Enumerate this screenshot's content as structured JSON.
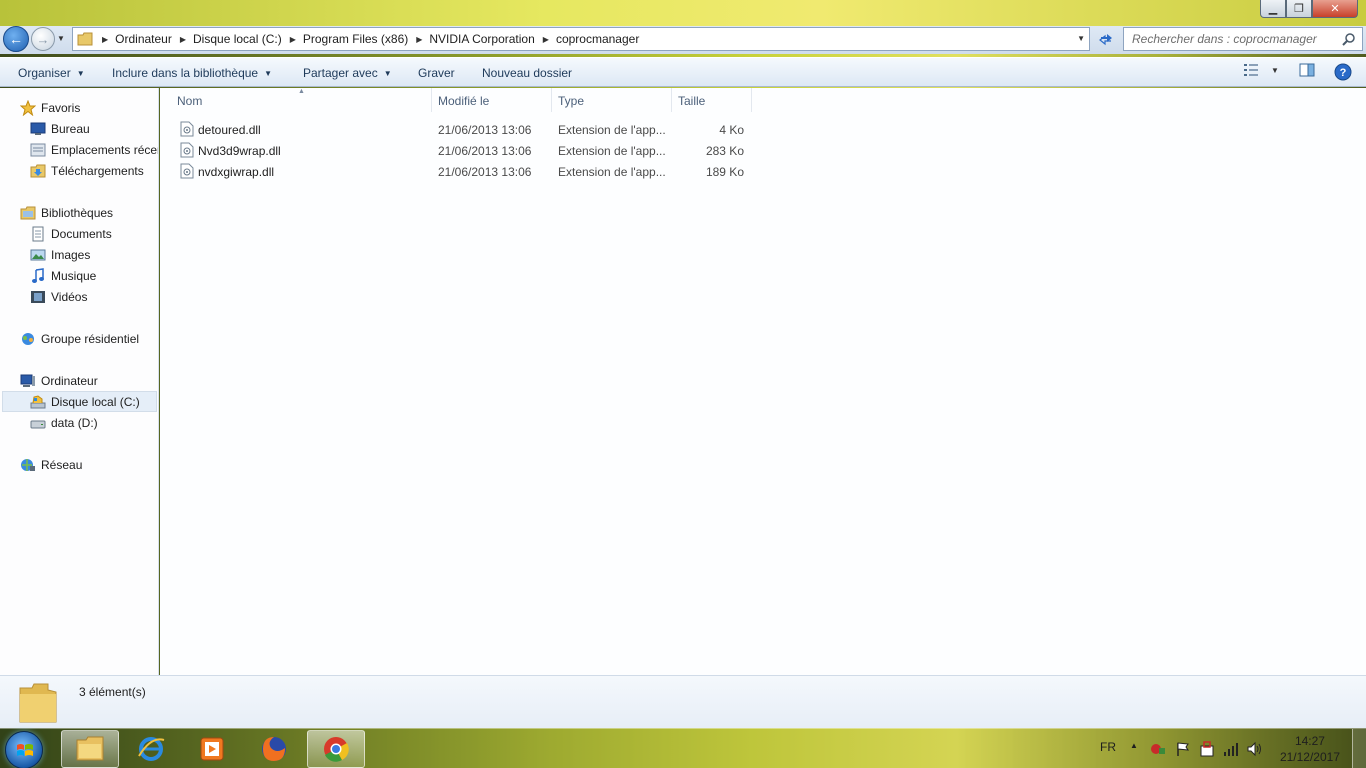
{
  "window": {
    "controls": {
      "minimize": "▁",
      "maximize": "❐",
      "close": "✕"
    }
  },
  "address_bar": {
    "back_glyph": "←",
    "forward_glyph": "→",
    "breadcrumbs": [
      "Ordinateur",
      "Disque local (C:)",
      "Program Files (x86)",
      "NVIDIA Corporation",
      "coprocmanager"
    ],
    "search_placeholder": "Rechercher dans : coprocmanager"
  },
  "toolbar": {
    "organize": "Organiser",
    "include_library": "Inclure dans la bibliothèque",
    "share_with": "Partager avec",
    "burn": "Graver",
    "new_folder": "Nouveau dossier"
  },
  "nav_pane": {
    "favorites": "Favoris",
    "favorites_items": [
      "Bureau",
      "Emplacements récents",
      "Téléchargements"
    ],
    "libraries": "Bibliothèques",
    "libraries_items": [
      "Documents",
      "Images",
      "Musique",
      "Vidéos"
    ],
    "homegroup": "Groupe résidentiel",
    "computer": "Ordinateur",
    "computer_items": [
      "Disque local (C:)",
      "data (D:)"
    ],
    "network": "Réseau"
  },
  "columns": {
    "name": "Nom",
    "modified": "Modifié le",
    "type": "Type",
    "size": "Taille"
  },
  "files": [
    {
      "name": "detoured.dll",
      "modified": "21/06/2013 13:06",
      "type": "Extension de l'app...",
      "size": "4 Ko"
    },
    {
      "name": "Nvd3d9wrap.dll",
      "modified": "21/06/2013 13:06",
      "type": "Extension de l'app...",
      "size": "283 Ko"
    },
    {
      "name": "nvdxgiwrap.dll",
      "modified": "21/06/2013 13:06",
      "type": "Extension de l'app...",
      "size": "189 Ko"
    }
  ],
  "details": {
    "item_count": "3 élément(s)"
  },
  "taskbar": {
    "language": "FR",
    "time": "14:27",
    "date": "21/12/2017"
  }
}
